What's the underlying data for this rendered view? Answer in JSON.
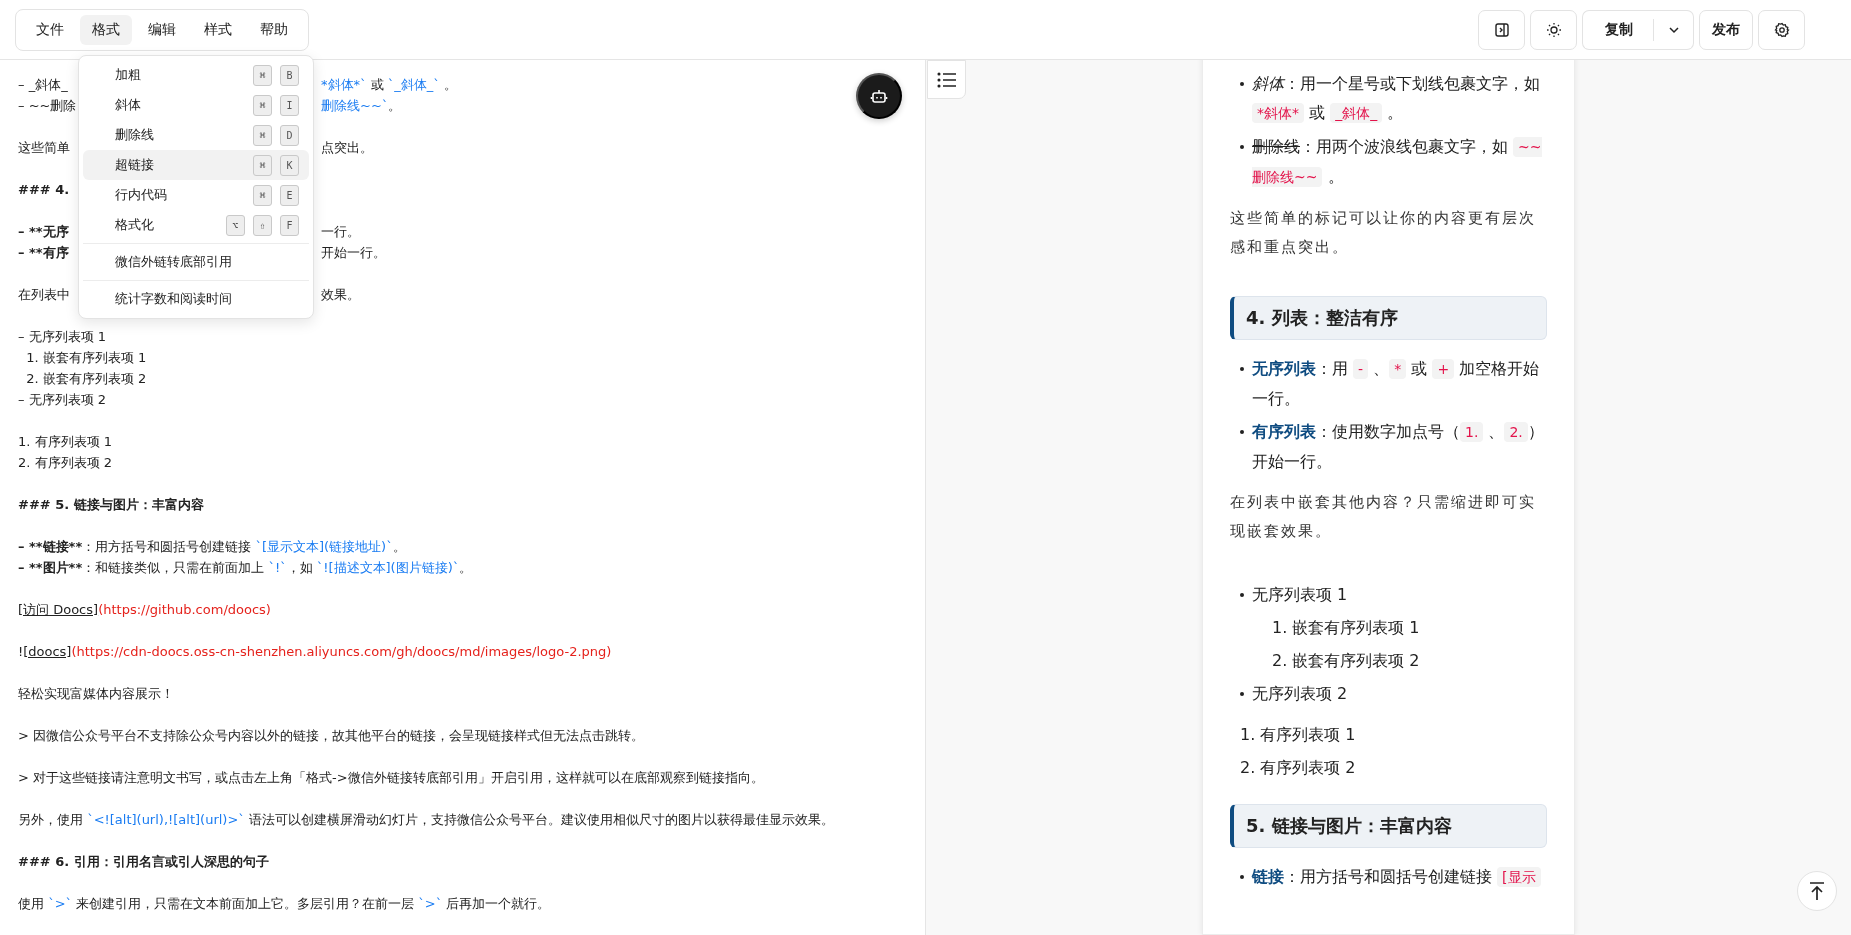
{
  "menubar": {
    "items": [
      {
        "label": "文件",
        "selected": false
      },
      {
        "label": "格式",
        "selected": true
      },
      {
        "label": "编辑",
        "selected": false
      },
      {
        "label": "样式",
        "selected": false
      },
      {
        "label": "帮助",
        "selected": false
      }
    ]
  },
  "format_menu": {
    "groups": [
      [
        {
          "label": "加粗",
          "keys": [
            "⌘",
            "B"
          ],
          "selected": false
        },
        {
          "label": "斜体",
          "keys": [
            "⌘",
            "I"
          ],
          "selected": false
        },
        {
          "label": "删除线",
          "keys": [
            "⌘",
            "D"
          ],
          "selected": false
        },
        {
          "label": "超链接",
          "keys": [
            "⌘",
            "K"
          ],
          "selected": true
        },
        {
          "label": "行内代码",
          "keys": [
            "⌘",
            "E"
          ],
          "selected": false
        },
        {
          "label": "格式化",
          "keys": [
            "⌥",
            "⇧",
            "F"
          ],
          "selected": false
        }
      ],
      [
        {
          "label": "微信外链转底部引用",
          "selected": false
        }
      ],
      [
        {
          "label": "统计字数和阅读时间",
          "selected": false
        }
      ]
    ]
  },
  "toolbar": {
    "copy_label": "复制",
    "publish_label": "发布"
  },
  "editor": {
    "lines": [
      {
        "kind": "covered",
        "left": [
          {
            "kind": "plain",
            "text": "– _斜体_"
          }
        ],
        "right": [
          {
            "kind": "code",
            "text": "*斜体*`"
          },
          {
            "kind": "plain",
            "text": " 或 "
          },
          {
            "kind": "code",
            "text": "`_斜体_`"
          },
          {
            "kind": "plain",
            "text": " 。"
          }
        ]
      },
      {
        "kind": "covered",
        "left": [
          {
            "kind": "plain",
            "text": "– ~~删除"
          }
        ],
        "right": [
          {
            "kind": "code",
            "text": "删除线~~`"
          },
          {
            "kind": "plain",
            "text": "。"
          }
        ]
      },
      {
        "kind": "blank"
      },
      {
        "kind": "covered",
        "left": [
          {
            "kind": "plain",
            "text": "这些简单"
          }
        ],
        "right": [
          {
            "kind": "plain",
            "text": "点突出。"
          }
        ]
      },
      {
        "kind": "blank"
      },
      {
        "kind": "covered",
        "left": [
          {
            "kind": "bold",
            "text": "### 4."
          }
        ]
      },
      {
        "kind": "blank"
      },
      {
        "kind": "covered",
        "left": [
          {
            "kind": "bold",
            "text": "– **无序"
          }
        ],
        "right": [
          {
            "kind": "plain",
            "text": "一行。"
          }
        ]
      },
      {
        "kind": "covered",
        "left": [
          {
            "kind": "bold",
            "text": "– **有序"
          }
        ],
        "right": [
          {
            "kind": "plain",
            "text": "开始一行。"
          }
        ]
      },
      {
        "kind": "blank"
      },
      {
        "kind": "covered",
        "left": [
          {
            "kind": "plain",
            "text": "在列表中"
          }
        ],
        "right": [
          {
            "kind": "plain",
            "text": "效果。"
          }
        ]
      },
      {
        "kind": "blank"
      },
      {
        "kind": "text",
        "segments": [
          {
            "kind": "plain",
            "text": "– 无序列表项 1"
          }
        ]
      },
      {
        "kind": "text",
        "segments": [
          {
            "kind": "plain",
            "text": "  1. 嵌套有序列表项 1"
          }
        ]
      },
      {
        "kind": "text",
        "segments": [
          {
            "kind": "plain",
            "text": "  2. 嵌套有序列表项 2"
          }
        ]
      },
      {
        "kind": "text",
        "segments": [
          {
            "kind": "plain",
            "text": "– 无序列表项 2"
          }
        ]
      },
      {
        "kind": "blank"
      },
      {
        "kind": "text",
        "segments": [
          {
            "kind": "plain",
            "text": "1. 有序列表项 1"
          }
        ]
      },
      {
        "kind": "text",
        "segments": [
          {
            "kind": "plain",
            "text": "2. 有序列表项 2"
          }
        ]
      },
      {
        "kind": "blank"
      },
      {
        "kind": "text",
        "segments": [
          {
            "kind": "bold",
            "text": "### 5. 链接与图片：丰富内容"
          }
        ]
      },
      {
        "kind": "blank"
      },
      {
        "kind": "text",
        "segments": [
          {
            "kind": "bold",
            "text": "– **链接**"
          },
          {
            "kind": "plain",
            "text": "：用方括号和圆括号创建链接 "
          },
          {
            "kind": "code",
            "text": "`[显示文本](链接地址)`"
          },
          {
            "kind": "plain",
            "text": "。"
          }
        ]
      },
      {
        "kind": "text",
        "segments": [
          {
            "kind": "bold",
            "text": "– **图片**"
          },
          {
            "kind": "plain",
            "text": "：和链接类似，只需在前面加上 "
          },
          {
            "kind": "code",
            "text": "`!`"
          },
          {
            "kind": "plain",
            "text": "，如 "
          },
          {
            "kind": "code",
            "text": "`![描述文本](图片链接)`"
          },
          {
            "kind": "plain",
            "text": "。"
          }
        ]
      },
      {
        "kind": "blank"
      },
      {
        "kind": "text",
        "segments": [
          {
            "kind": "link",
            "text": "[访问 Doocs]"
          },
          {
            "kind": "url",
            "text": "(https://github.com/doocs)"
          }
        ]
      },
      {
        "kind": "blank"
      },
      {
        "kind": "text",
        "segments": [
          {
            "kind": "plain",
            "text": "!"
          },
          {
            "kind": "link",
            "text": "[doocs]"
          },
          {
            "kind": "url",
            "text": "(https://cdn-doocs.oss-cn-shenzhen.aliyuncs.com/gh/doocs/md/images/logo-2.png)"
          }
        ]
      },
      {
        "kind": "blank"
      },
      {
        "kind": "text",
        "segments": [
          {
            "kind": "plain",
            "text": "轻松实现富媒体内容展示！"
          }
        ]
      },
      {
        "kind": "blank"
      },
      {
        "kind": "text",
        "segments": [
          {
            "kind": "plain",
            "text": "> 因微信公众号平台不支持除公众号内容以外的链接，故其他平台的链接，会呈现链接样式但无法点击跳转。"
          }
        ]
      },
      {
        "kind": "blank"
      },
      {
        "kind": "text",
        "segments": [
          {
            "kind": "plain",
            "text": "> 对于这些链接请注意明文书写，或点击左上角「格式->微信外链接转底部引用」开启引用，这样就可以在底部观察到链接指向。"
          }
        ]
      },
      {
        "kind": "blank"
      },
      {
        "kind": "text",
        "segments": [
          {
            "kind": "plain",
            "text": "另外，使用 "
          },
          {
            "kind": "code",
            "text": "`<![alt](url),![alt](url)>`"
          },
          {
            "kind": "plain",
            "text": " 语法可以创建横屏滑动幻灯片，支持微信公众号平台。建议使用相似尺寸的图片以获得最佳显示效果。"
          }
        ]
      },
      {
        "kind": "blank"
      },
      {
        "kind": "text",
        "segments": [
          {
            "kind": "bold",
            "text": "### 6. 引用：引用名言或引人深思的句子"
          }
        ]
      },
      {
        "kind": "blank"
      },
      {
        "kind": "text",
        "segments": [
          {
            "kind": "plain",
            "text": "使用 "
          },
          {
            "kind": "code",
            "text": "`>`"
          },
          {
            "kind": "plain",
            "text": " 来创建引用，只需在文本前面加上它。多层引用？在前一层 "
          },
          {
            "kind": "code",
            "text": "`>`"
          },
          {
            "kind": "plain",
            "text": " 后再加一个就行。"
          }
        ]
      }
    ]
  },
  "preview": {
    "blocks": [
      {
        "kind": "list",
        "items": [
          {
            "kind": "bullet",
            "segments": [
              {
                "kind": "italic",
                "text": "斜体"
              },
              {
                "kind": "plain",
                "text": "：用一个星号或下划线包裹文字，如 "
              },
              {
                "kind": "code",
                "text": "*斜体*"
              },
              {
                "kind": "plain",
                "text": " 或 "
              },
              {
                "kind": "code",
                "text": "_斜体_"
              },
              {
                "kind": "plain",
                "text": " 。"
              }
            ]
          },
          {
            "kind": "bullet",
            "segments": [
              {
                "kind": "strike",
                "text": "删除线"
              },
              {
                "kind": "plain",
                "text": "：用两个波浪线包裹文字，如 "
              },
              {
                "kind": "code",
                "text": "~~删除线~~"
              },
              {
                "kind": "plain",
                "text": " 。"
              }
            ]
          }
        ]
      },
      {
        "kind": "para",
        "text": "这些简单的标记可以让你的内容更有层次感和重点突出。"
      },
      {
        "kind": "heading",
        "text": "4. 列表：整洁有序"
      },
      {
        "kind": "list",
        "items": [
          {
            "kind": "bullet",
            "segments": [
              {
                "kind": "strong",
                "text": "无序列表"
              },
              {
                "kind": "plain",
                "text": "：用 "
              },
              {
                "kind": "code",
                "text": "-"
              },
              {
                "kind": "plain",
                "text": " 、"
              },
              {
                "kind": "code",
                "text": "*"
              },
              {
                "kind": "plain",
                "text": " 或 "
              },
              {
                "kind": "code",
                "text": "+"
              },
              {
                "kind": "plain",
                "text": " 加空格开始一行。"
              }
            ]
          },
          {
            "kind": "bullet",
            "segments": [
              {
                "kind": "strong",
                "text": "有序列表"
              },
              {
                "kind": "plain",
                "text": "：使用数字加点号（"
              },
              {
                "kind": "code",
                "text": "1."
              },
              {
                "kind": "plain",
                "text": " 、"
              },
              {
                "kind": "code",
                "text": "2."
              },
              {
                "kind": "plain",
                "text": "）开始一行。"
              }
            ]
          }
        ]
      },
      {
        "kind": "para",
        "text": "在列表中嵌套其他内容？只需缩进即可实现嵌套效果。"
      },
      {
        "kind": "list",
        "items": [
          {
            "kind": "bullet",
            "segments": [
              {
                "kind": "plain",
                "text": "无序列表项 1"
              }
            ],
            "children": [
              {
                "kind": "numbered",
                "marker": "1.",
                "segments": [
                  {
                    "kind": "plain",
                    "text": "嵌套有序列表项 1"
                  }
                ]
              },
              {
                "kind": "numbered",
                "marker": "2.",
                "segments": [
                  {
                    "kind": "plain",
                    "text": "嵌套有序列表项 2"
                  }
                ]
              }
            ]
          },
          {
            "kind": "bullet",
            "segments": [
              {
                "kind": "plain",
                "text": "无序列表项 2"
              }
            ]
          }
        ]
      },
      {
        "kind": "list",
        "items": [
          {
            "kind": "numbered",
            "marker": "1.",
            "segments": [
              {
                "kind": "plain",
                "text": "有序列表项 1"
              }
            ]
          },
          {
            "kind": "numbered",
            "marker": "2.",
            "segments": [
              {
                "kind": "plain",
                "text": "有序列表项 2"
              }
            ]
          }
        ]
      },
      {
        "kind": "heading",
        "text": "5. 链接与图片：丰富内容"
      },
      {
        "kind": "list",
        "items": [
          {
            "kind": "bullet",
            "segments": [
              {
                "kind": "strong",
                "text": "链接"
              },
              {
                "kind": "plain",
                "text": "：用方括号和圆括号创建链接 "
              },
              {
                "kind": "code",
                "text": "[显示"
              }
            ]
          }
        ]
      }
    ]
  }
}
